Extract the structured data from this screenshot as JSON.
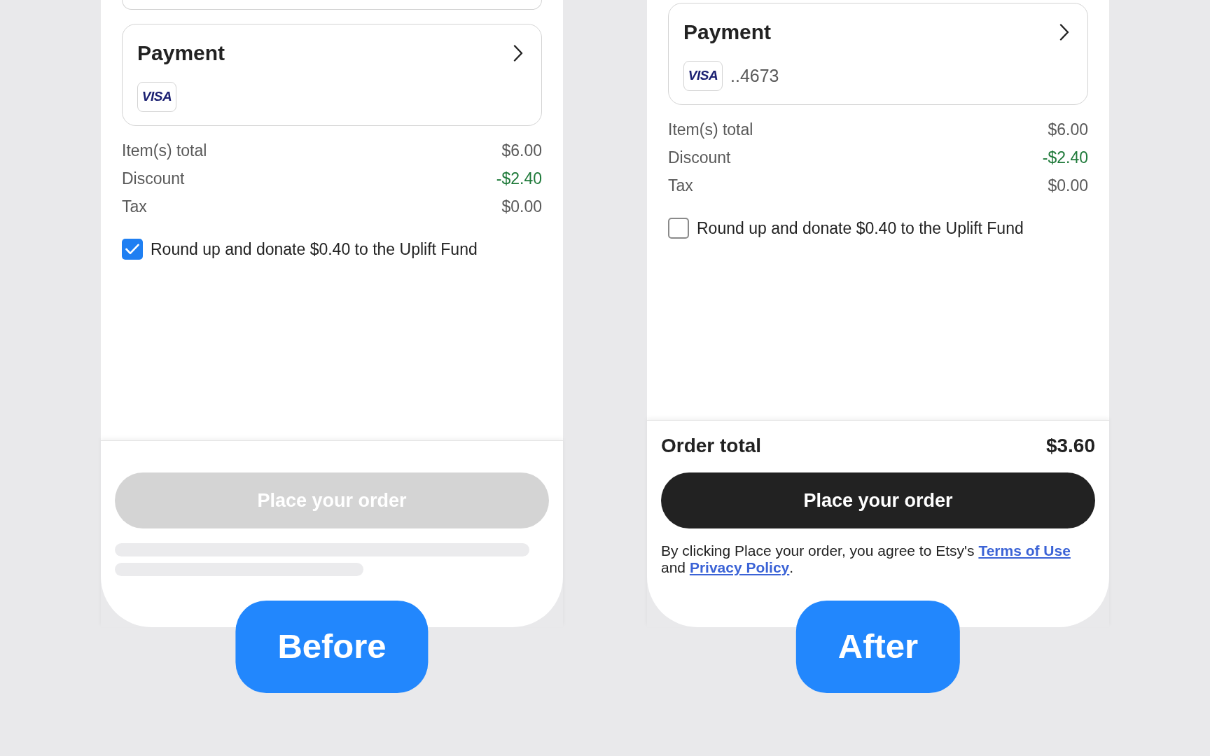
{
  "panels": [
    {
      "cards": [
        {
          "kind": "partial"
        },
        {
          "kind": "payment",
          "title": "Payment",
          "card_brand": "VISA"
        }
      ],
      "summary": [
        {
          "label": "Item(s) total",
          "amount": "$6.00",
          "kind": "charge"
        },
        {
          "label": "Discount",
          "amount": "-$2.40",
          "kind": "discount"
        },
        {
          "label": "Tax",
          "amount": "$0.00",
          "kind": "charge"
        }
      ],
      "donation": {
        "label": "Round up and donate $0.40 to the Uplift Fund",
        "checked": true
      },
      "place_order": {
        "label": "Place your order",
        "disabled": true
      },
      "legal": {
        "kind": "skeleton"
      },
      "caption": "Before"
    },
    {
      "cards": [
        {
          "kind": "payment",
          "title": "Payment",
          "card_brand": "VISA",
          "card_number": "..4673"
        }
      ],
      "summary": [
        {
          "label": "Item(s) total",
          "amount": "$6.00",
          "kind": "charge"
        },
        {
          "label": "Discount",
          "amount": "-$2.40",
          "kind": "discount"
        },
        {
          "label": "Tax",
          "amount": "$0.00",
          "kind": "charge"
        }
      ],
      "donation": {
        "label": "Round up and donate $0.40 to the Uplift Fund",
        "checked": false
      },
      "order_total": {
        "label": "Order total",
        "amount": "$3.60"
      },
      "place_order": {
        "label": "Place your order",
        "disabled": false
      },
      "legal": {
        "kind": "text",
        "parts": [
          {
            "kind": "text",
            "text": "By clicking Place your order, you agree to Etsy's "
          },
          {
            "kind": "link",
            "text": "Terms of Use"
          },
          {
            "kind": "text",
            "text": " and "
          },
          {
            "kind": "link",
            "text": "Privacy Policy"
          },
          {
            "kind": "text",
            "text": "."
          }
        ]
      },
      "caption": "After"
    }
  ]
}
